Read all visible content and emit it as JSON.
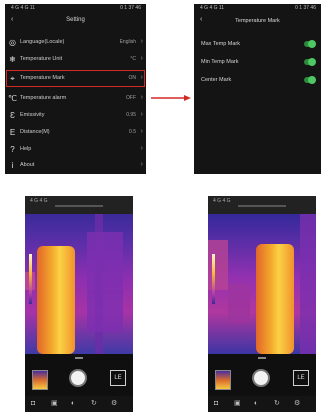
{
  "settings_screen": {
    "status_left": "4 G 4 G 11",
    "status_right": "0 1 37 46",
    "back_icon": "chevron-left-icon",
    "title": "Setting",
    "items": [
      {
        "icon": "globe-icon",
        "glyph": "◎",
        "label": "Language(Locale)",
        "value": "English"
      },
      {
        "icon": "thermometer-icon",
        "glyph": "❄",
        "label": "Temperature Unit",
        "value": "°C"
      },
      {
        "icon": "crosshair-icon",
        "glyph": "⌖",
        "label": "Temperature Mark",
        "value": "ON"
      },
      {
        "icon": "thermometer-alarm-icon",
        "glyph": "℃",
        "label": "Temperature alarm",
        "value": "OFF"
      },
      {
        "icon": "emissivity-icon",
        "glyph": "Ɛ",
        "label": "Emissivity",
        "value": "0.95"
      },
      {
        "icon": "distance-icon",
        "glyph": "E",
        "label": "Distance(M)",
        "value": "0.5"
      },
      {
        "icon": "help-icon",
        "glyph": "?",
        "label": "Help",
        "value": ""
      },
      {
        "icon": "info-icon",
        "glyph": "i",
        "label": "About",
        "value": ""
      }
    ],
    "highlight_color": "#d42a25"
  },
  "arrow_color": "#d42a25",
  "mark_screen": {
    "title": "Temperature Mark",
    "items": [
      {
        "label": "Max Temp Mark",
        "on": true
      },
      {
        "label": "Min Temp Mark",
        "on": true
      },
      {
        "label": "Center Mark",
        "on": true
      }
    ],
    "toggle_color": "#4ec865"
  },
  "camera_screens": [
    {
      "status": "4 G 4 G",
      "mode_label": "LE",
      "nav_icons": [
        "camera-icon",
        "image-icon",
        "palette-icon",
        "rotate-icon",
        "settings-icon"
      ]
    },
    {
      "status": "4 G 4 G",
      "mode_label": "LE",
      "nav_icons": [
        "camera-icon",
        "image-icon",
        "palette-icon",
        "rotate-icon",
        "settings-icon"
      ]
    }
  ]
}
